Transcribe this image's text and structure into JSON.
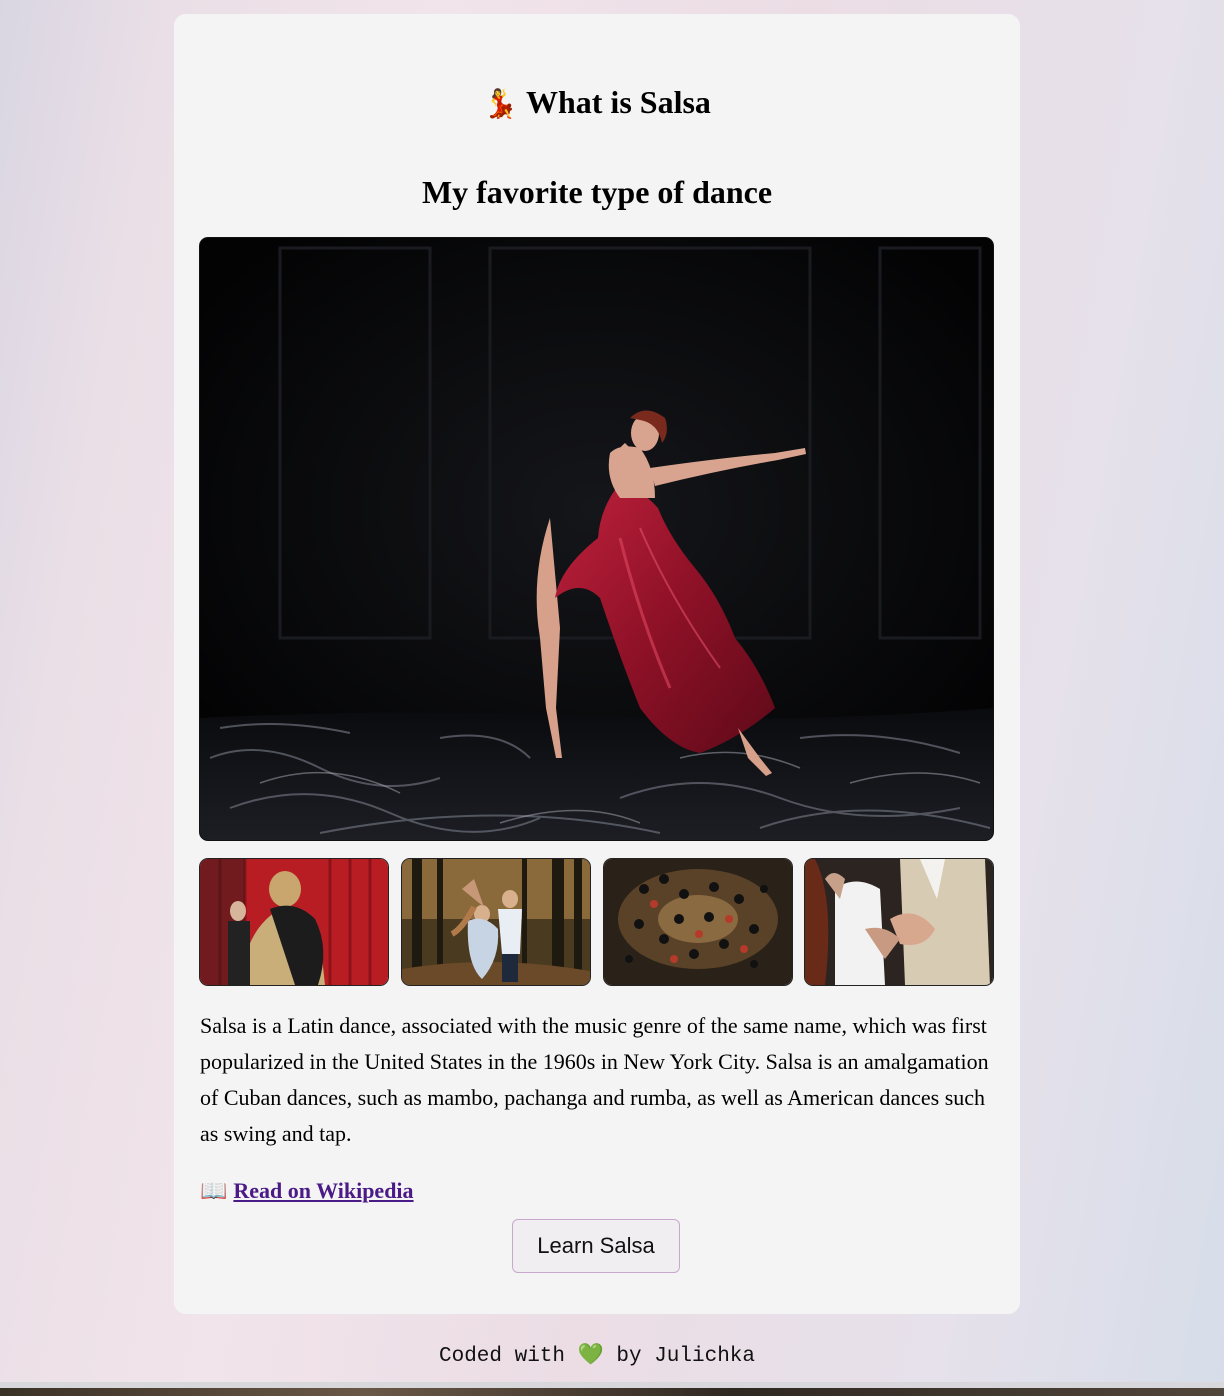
{
  "header": {
    "title_icon": "dancer-emoji",
    "title": "What is Salsa",
    "subtitle": "My favorite type of dance"
  },
  "gallery": {
    "hero_alt": "Dancer in a red satin dress leaping on a dark stage with black satin floor",
    "thumbnails": [
      {
        "alt": "Couple embracing in front of a red curtain"
      },
      {
        "alt": "Couple dancing in a forest"
      },
      {
        "alt": "Crowd of dancers seen from above"
      },
      {
        "alt": "Close-up of couple dancing in white clothes"
      }
    ]
  },
  "description": "Salsa is a Latin dance, associated with the music genre of the same name, which was first popularized in the United States in the 1960s in New York City. Salsa is an amalgamation of Cuban dances, such as mambo, pachanga and rumba, as well as American dances such as swing and tap.",
  "wiki_link": {
    "icon": "book-icon",
    "label": "Read on Wikipedia"
  },
  "cta_button": {
    "label": "Learn Salsa"
  },
  "footer": {
    "prefix": "Coded with",
    "heart_icon": "green-heart-icon",
    "suffix": "by Julichka"
  },
  "colors": {
    "link": "#4a1a86",
    "card_bg": "#f4f4f4",
    "button_border": "#c9a7cf",
    "heart": "#3fb94a"
  }
}
